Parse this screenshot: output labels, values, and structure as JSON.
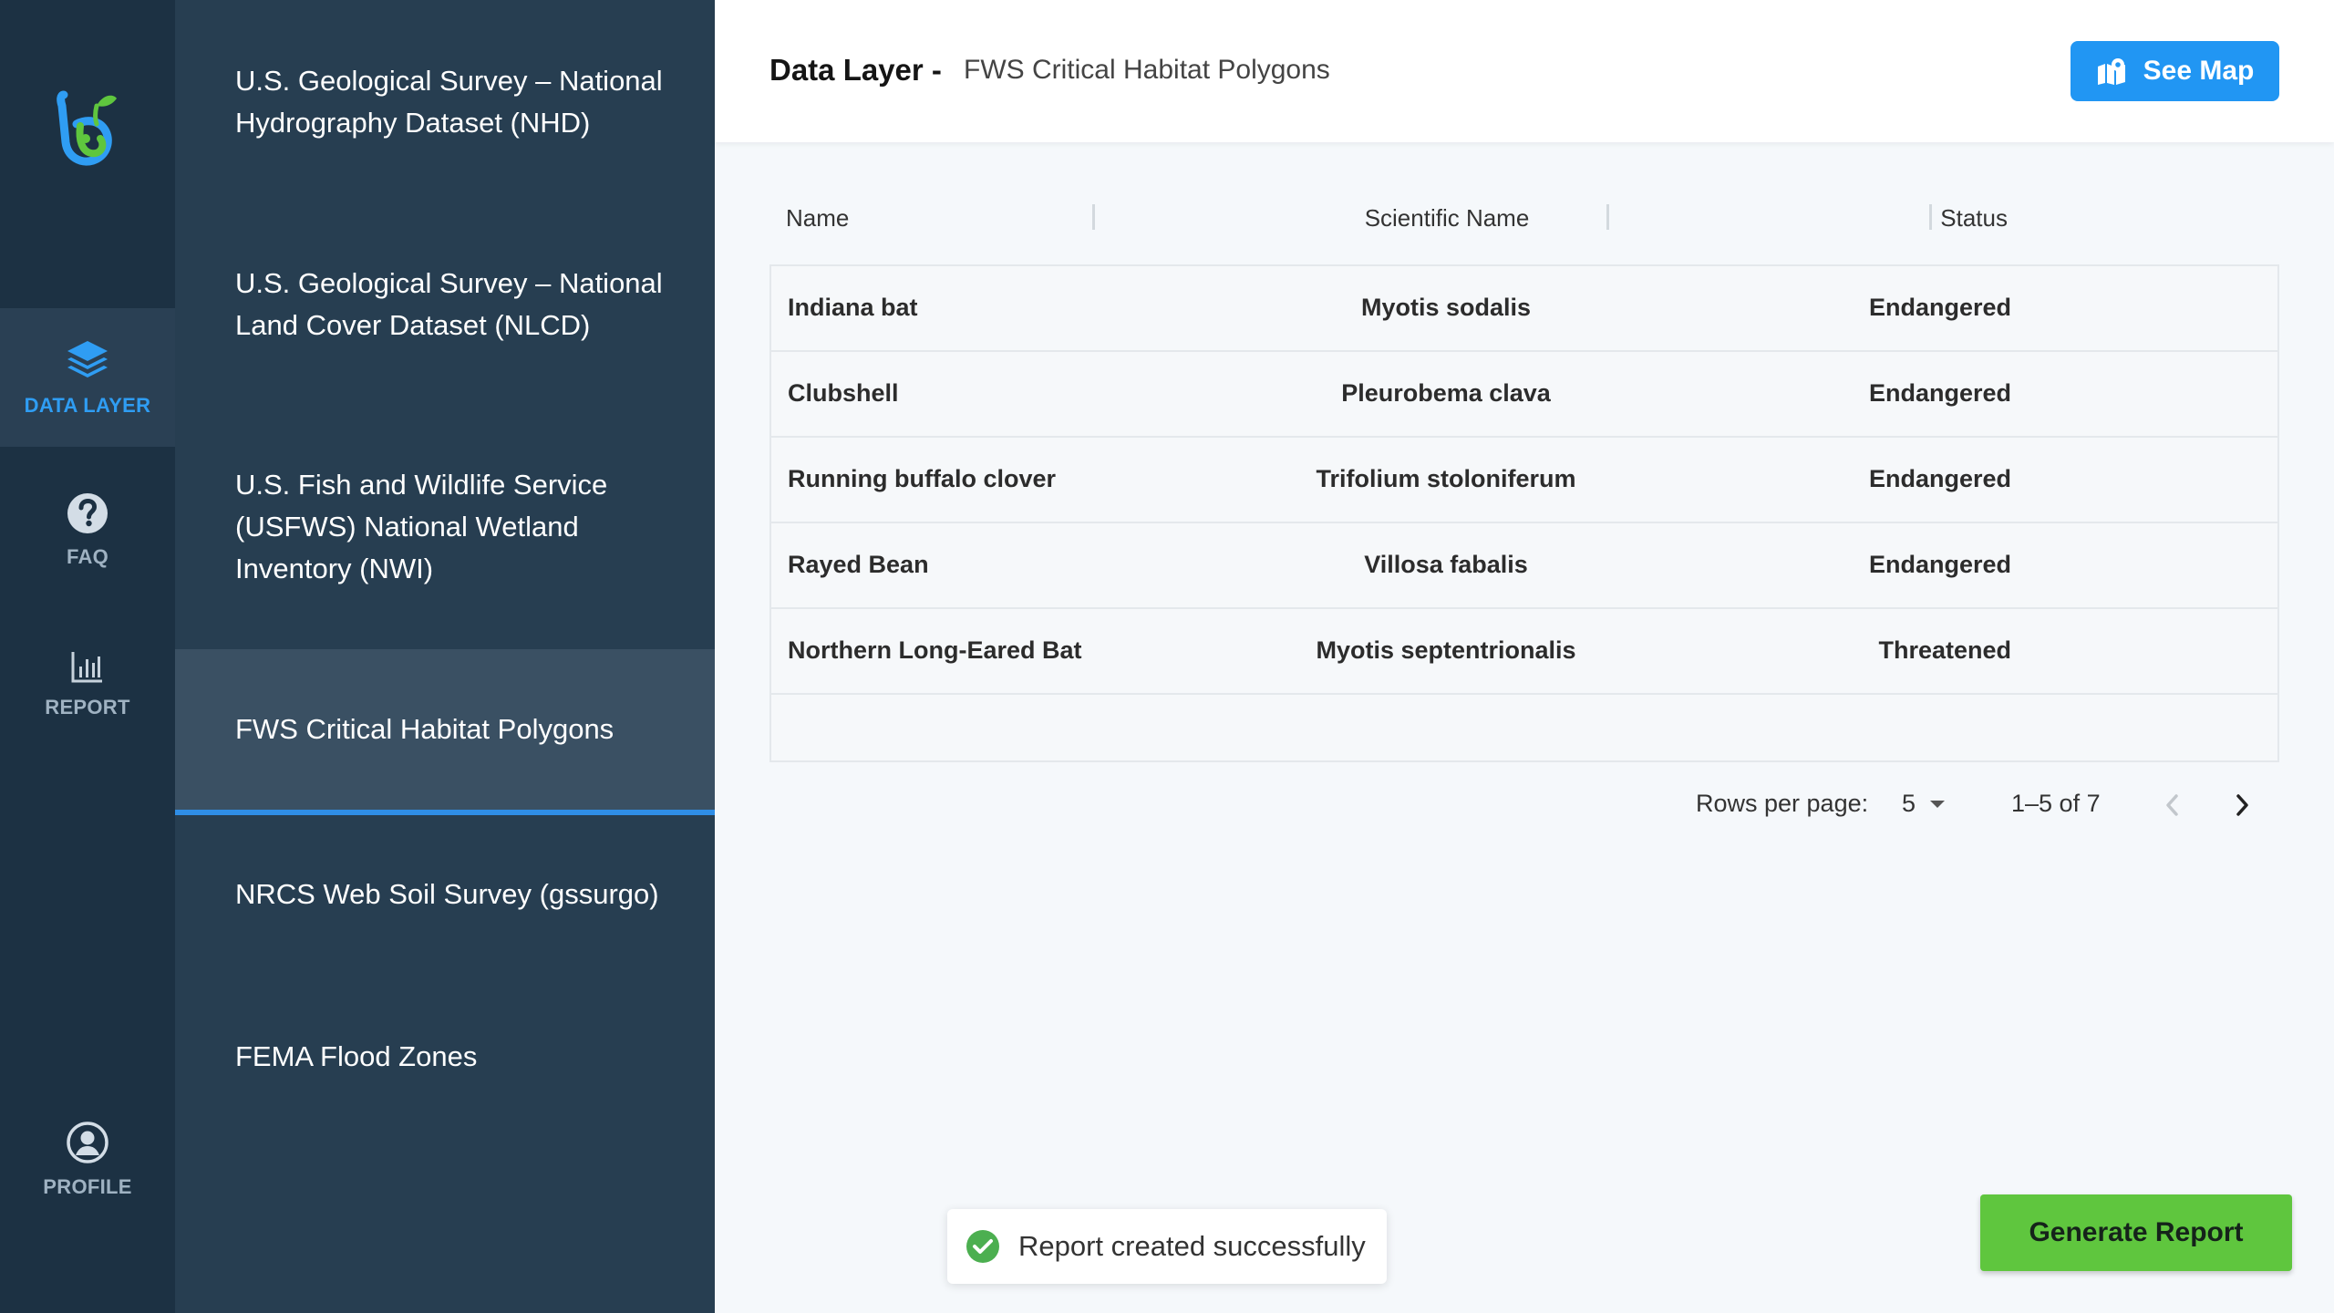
{
  "nav": {
    "items": [
      {
        "key": "data_layer",
        "label": "DATA LAYER",
        "icon": "layers-icon",
        "active": true
      },
      {
        "key": "faq",
        "label": "FAQ",
        "icon": "help-icon",
        "active": false
      },
      {
        "key": "report",
        "label": "REPORT",
        "icon": "bar-chart-icon",
        "active": false
      },
      {
        "key": "profile",
        "label": "PROFILE",
        "icon": "user-circle-icon",
        "active": false
      }
    ]
  },
  "layers": [
    {
      "label": "U.S. Geological Survey – National Hydrography Dataset (NHD)"
    },
    {
      "label": "U.S. Geological Survey – National Land Cover Dataset (NLCD)"
    },
    {
      "label": "U.S. Fish and Wildlife Service (USFWS) National Wetland Inventory (NWI)"
    },
    {
      "label": "FWS Critical Habitat Polygons",
      "active": true
    },
    {
      "label": "NRCS Web Soil Survey (gssurgo)"
    },
    {
      "label": "FEMA Flood Zones"
    }
  ],
  "header": {
    "title": "Data Layer -",
    "subtitle": "FWS Critical Habitat Polygons",
    "see_map_label": "See Map"
  },
  "table": {
    "columns": [
      "Name",
      "Scientific Name",
      "Status"
    ],
    "rows": [
      {
        "name": "Indiana bat",
        "scientific": "Myotis sodalis",
        "status": "Endangered"
      },
      {
        "name": "Clubshell",
        "scientific": "Pleurobema clava",
        "status": "Endangered"
      },
      {
        "name": "Running buffalo clover",
        "scientific": "Trifolium stoloniferum",
        "status": "Endangered"
      },
      {
        "name": "Rayed Bean",
        "scientific": "Villosa fabalis",
        "status": "Endangered"
      },
      {
        "name": "Northern Long-Eared Bat",
        "scientific": "Myotis septentrionalis",
        "status": "Threatened"
      }
    ]
  },
  "pagination": {
    "rows_per_page_label": "Rows per page:",
    "rows_per_page": "5",
    "range": "1–5 of 7"
  },
  "toast": {
    "message": "Report created successfully"
  },
  "actions": {
    "generate_report": "Generate Report"
  },
  "colors": {
    "accent": "#2196f3",
    "success": "#5fc63e",
    "rail": "#1c3143",
    "panel": "#273e51"
  }
}
